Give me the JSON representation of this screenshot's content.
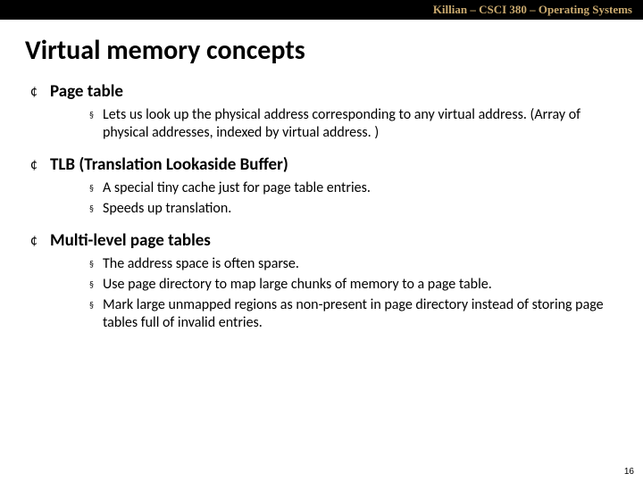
{
  "header": "Killian – CSCI 380 – Operating Systems",
  "title": "Virtual memory concepts",
  "items": [
    {
      "label": "Page table",
      "subs": [
        "Lets us look up the physical address corresponding to any virtual address. (Array of physical addresses, indexed by virtual address. )"
      ]
    },
    {
      "label": "TLB (Translation Lookaside Buffer)",
      "subs": [
        "A special tiny cache just for page table entries.",
        "Speeds up translation."
      ]
    },
    {
      "label": "Multi-level page tables",
      "subs": [
        "The address space is often sparse.",
        "Use page directory to map large chunks of memory to a page table.",
        "Mark large unmapped regions as non-present in page directory instead of storing page tables full of invalid entries."
      ]
    }
  ],
  "pageNumber": "16"
}
